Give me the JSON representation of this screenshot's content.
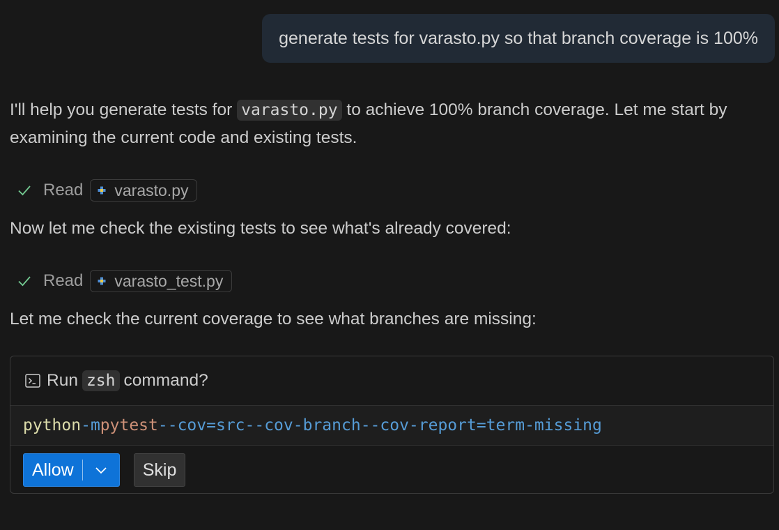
{
  "user_message": "generate tests for varasto.py so that branch coverage is 100%",
  "assistant": {
    "intro_before": "I'll help you generate tests for ",
    "intro_code": "varasto.py",
    "intro_after": " to achieve 100% branch coverage. Let me start by examining the current code and existing tests.",
    "reads": [
      {
        "verb": "Read",
        "file": "varasto.py"
      },
      {
        "verb": "Read",
        "file": "varasto_test.py"
      }
    ],
    "msg_check_tests": "Now let me check the existing tests to see what's already covered:",
    "msg_check_coverage": "Let me check the current coverage to see what branches are missing:"
  },
  "command_prompt": {
    "title_before": "Run",
    "shell": "zsh",
    "title_after": "command?",
    "tokens": {
      "cmd": "python",
      "flag1": "-m",
      "arg1": "pytest",
      "flag2": "--cov=src",
      "flag3": "--cov-branch",
      "flag4": "--cov-report=term-missing"
    },
    "allow_label": "Allow",
    "skip_label": "Skip"
  },
  "icons": {
    "check": "check-icon",
    "file": "python-file-icon",
    "terminal": "terminal-icon",
    "chevron": "chevron-down-icon"
  },
  "colors": {
    "background": "#181818",
    "user_bubble": "#212a35",
    "check_green": "#73c991",
    "allow_blue": "#0e73d8",
    "token_cmd": "#dcdcaa",
    "token_flag": "#569cd6",
    "token_arg": "#ce9178"
  }
}
